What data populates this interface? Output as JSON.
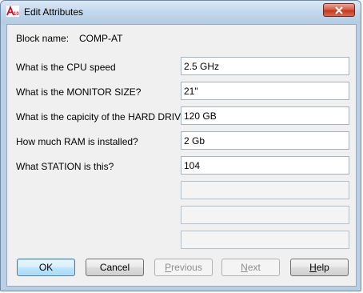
{
  "window": {
    "title": "Edit Attributes"
  },
  "block": {
    "label": "Block name:",
    "value": "COMP-AT"
  },
  "attributes": [
    {
      "prompt": "What is the CPU speed",
      "value": "2.5 GHz"
    },
    {
      "prompt": "What is the MONITOR SIZE?",
      "value": "21\""
    },
    {
      "prompt": "What is the capicity of the HARD DRIV",
      "value": "120 GB"
    },
    {
      "prompt": "How much RAM is installed?",
      "value": "2 Gb"
    },
    {
      "prompt": "What STATION is this?",
      "value": "104"
    }
  ],
  "buttons": {
    "ok": "OK",
    "cancel": "Cancel",
    "previous_first": "P",
    "previous_rest": "revious",
    "next_first": "N",
    "next_rest": "ext",
    "help_first": "H",
    "help_rest": "elp"
  },
  "icons": {
    "app": "autocad-logo-icon",
    "close": "close-icon"
  },
  "colors": {
    "close_button": "#c1391f",
    "default_button_border": "#3c7fb1",
    "app_icon_red": "#c8102e"
  }
}
